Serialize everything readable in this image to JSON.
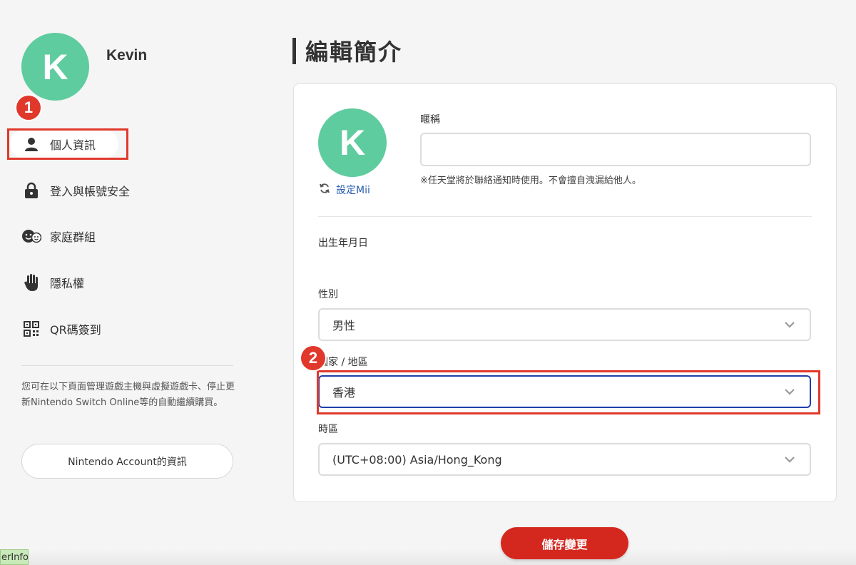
{
  "user": {
    "initial": "K",
    "name": "Kevin"
  },
  "badges": {
    "one": "1",
    "two": "2"
  },
  "sidebar": {
    "items": [
      {
        "label": "個人資訊",
        "icon": "person-icon"
      },
      {
        "label": "登入與帳號安全",
        "icon": "lock-icon"
      },
      {
        "label": "家庭群組",
        "icon": "family-icon"
      },
      {
        "label": "隱私權",
        "icon": "hand-icon"
      },
      {
        "label": "QR碼簽到",
        "icon": "qr-code-icon"
      }
    ],
    "note": "您可在以下頁面管理遊戲主機與虛擬遊戲卡、停止更新Nintendo Switch Online等的自動繼續購買。",
    "account_button": "Nintendo Account的資訊"
  },
  "main": {
    "title": "編輯簡介",
    "mii_link": "設定Mii",
    "nickname": {
      "label": "暱稱",
      "value": "",
      "hint": "※任天堂將於聯絡通知時使用。不會擅自洩漏給他人。"
    },
    "birthday": {
      "label": "出生年月日"
    },
    "gender": {
      "label": "性別",
      "value": "男性"
    },
    "country": {
      "label": "國家 / 地區",
      "value": "香港"
    },
    "timezone": {
      "label": "時區",
      "value": "(UTC+08:00) Asia/Hong_Kong"
    },
    "save_button": "儲存變更"
  },
  "corner_tag": "erInfo",
  "colors": {
    "accent_red": "#d4281f",
    "avatar_green": "#5fcc9f",
    "highlight_red": "#e0382b",
    "link_blue": "#2a5db0"
  }
}
